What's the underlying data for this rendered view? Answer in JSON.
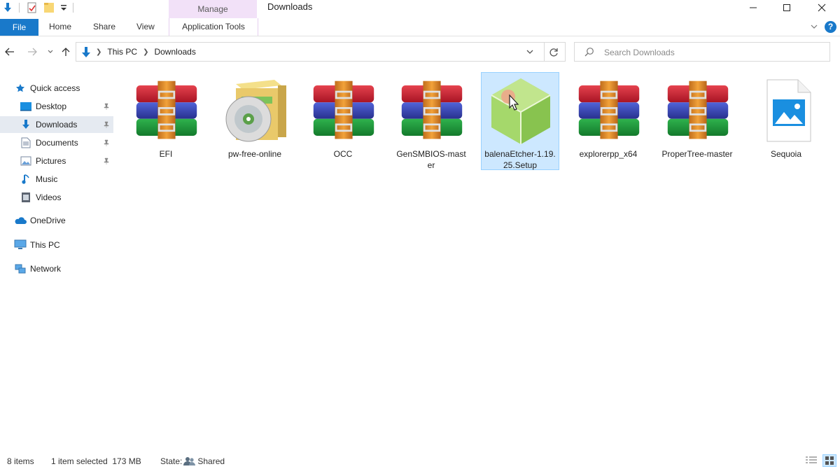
{
  "window": {
    "title": "Downloads",
    "contextual_group": "Manage"
  },
  "ribbon": {
    "tabs": [
      "File",
      "Home",
      "Share",
      "View",
      "Application Tools"
    ]
  },
  "address": {
    "crumbs": [
      "This PC",
      "Downloads"
    ],
    "search_placeholder": "Search Downloads"
  },
  "nav": {
    "quick_access": "Quick access",
    "items": [
      "Desktop",
      "Downloads",
      "Documents",
      "Pictures",
      "Music",
      "Videos"
    ],
    "onedrive": "OneDrive",
    "thispc": "This PC",
    "network": "Network"
  },
  "files": [
    {
      "name": "EFI",
      "icon": "winrar-archive-icon"
    },
    {
      "name": "pw-free-online",
      "icon": "installer-box-cd-icon"
    },
    {
      "name": "OCC",
      "icon": "winrar-archive-icon"
    },
    {
      "name": "GenSMBIOS-master",
      "icon": "winrar-archive-icon"
    },
    {
      "name": "balenaEtcher-1.19.25.Setup",
      "icon": "balena-etcher-icon",
      "selected": true
    },
    {
      "name": "explorerpp_x64",
      "icon": "winrar-archive-icon"
    },
    {
      "name": "ProperTree-master",
      "icon": "winrar-archive-icon"
    },
    {
      "name": "Sequoia",
      "icon": "image-file-icon"
    }
  ],
  "status": {
    "count": "8 items",
    "selected": "1 item selected  173 MB",
    "state_label": "State:",
    "state_value": "Shared"
  },
  "colors": {
    "accent": "#1979ca",
    "selection": "#cde8ff",
    "manage_tab": "#f2e1f8"
  }
}
